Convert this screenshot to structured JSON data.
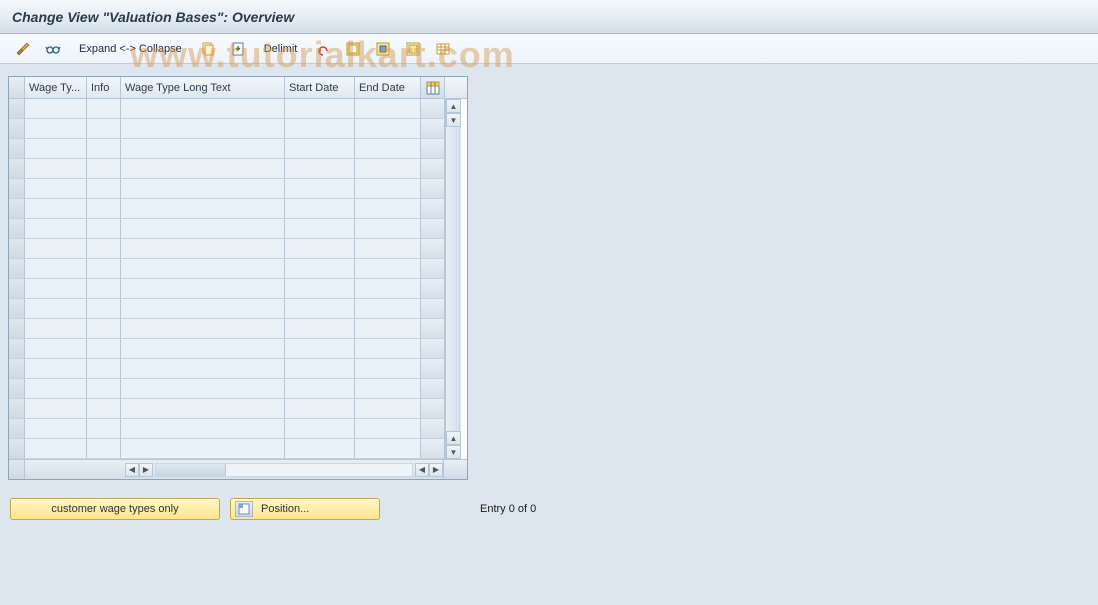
{
  "title": "Change View \"Valuation Bases\": Overview",
  "watermark": "www.tutorialkart.com",
  "toolbar": {
    "expand_collapse_label": "Expand <-> Collapse",
    "delimit_label": "Delimit",
    "icons": {
      "other_view": "other-view-icon",
      "display_change": "display-change-icon",
      "copy": "copy-icon",
      "paste": "paste-icon",
      "undo": "undo-icon",
      "select_all": "select-all-icon",
      "select_block": "select-block-icon",
      "deselect_all": "deselect-all-icon",
      "config": "config-icon"
    }
  },
  "table": {
    "columns": {
      "wage_type": "Wage Ty...",
      "info": "Info",
      "long_text": "Wage Type Long Text",
      "start_date": "Start Date",
      "end_date": "End Date"
    },
    "row_count": 18,
    "rows": []
  },
  "footer": {
    "customer_button": "customer wage types only",
    "position_button": "Position...",
    "entry_text": "Entry 0 of 0"
  },
  "colors": {
    "row_bg": "#eaf1f7",
    "border": "#b5c6d6"
  },
  "scroll": {
    "up": "▲",
    "down": "▼",
    "left": "◀",
    "right": "▶"
  }
}
